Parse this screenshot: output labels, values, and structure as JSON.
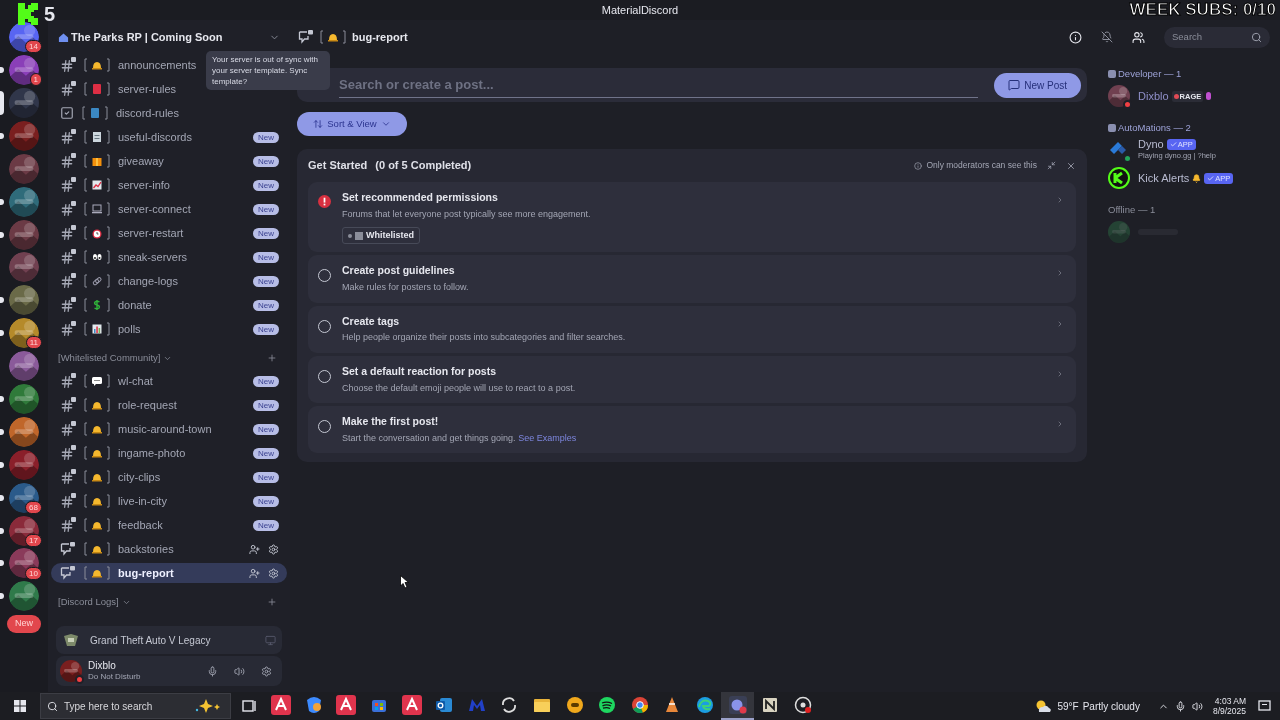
{
  "overlay": {
    "streak": "5",
    "subs": "WEEK SUBS: 0/10"
  },
  "window": {
    "title": "MaterialDiscord"
  },
  "servers": [
    {
      "badge": "14",
      "selected": false,
      "unread": false
    },
    {
      "badge": "1",
      "selected": false,
      "unread": true
    },
    {
      "selected": true
    },
    {
      "selected": false,
      "unread": true
    },
    {
      "selected": false,
      "unread": false
    },
    {
      "selected": false,
      "unread": true
    },
    {
      "selected": false,
      "unread": true
    },
    {
      "selected": false,
      "unread": false
    },
    {
      "selected": false,
      "unread": true
    },
    {
      "badge": "11",
      "selected": false,
      "unread": true
    },
    {
      "selected": false,
      "unread": false
    },
    {
      "selected": false,
      "unread": true
    },
    {
      "selected": false,
      "unread": true
    },
    {
      "selected": false,
      "unread": true
    },
    {
      "badge": "68",
      "selected": false,
      "unread": true
    },
    {
      "badge": "17",
      "selected": false,
      "unread": true
    },
    {
      "badge": "10",
      "selected": false,
      "unread": true
    },
    {
      "selected": false,
      "unread": true
    }
  ],
  "servers_new": "New",
  "server": {
    "name": "The Parks RP | Coming Soon",
    "tooltip": "Your server is out of sync with your server template. Sync template?"
  },
  "channel_groups": [
    {
      "channels": [
        {
          "kind": "text",
          "emoji": {
            "kind": "bell"
          },
          "name": "announcements",
          "selected": false
        },
        {
          "kind": "text",
          "emoji": {
            "kind": "red-book"
          },
          "name": "server-rules",
          "selected": false
        },
        {
          "kind": "rules",
          "emoji": {
            "kind": "blue-book"
          },
          "name": "discord-rules",
          "selected": false
        },
        {
          "kind": "text",
          "emoji": {
            "kind": "document"
          },
          "name": "useful-discords",
          "badge": "New",
          "selected": false
        },
        {
          "kind": "text",
          "emoji": {
            "kind": "gift"
          },
          "name": "giveaway",
          "badge": "New",
          "selected": false
        },
        {
          "kind": "text",
          "emoji": {
            "kind": "chart"
          },
          "name": "server-info",
          "badge": "New",
          "selected": false
        },
        {
          "kind": "text",
          "emoji": {
            "kind": "laptop"
          },
          "name": "server-connect",
          "badge": "New",
          "selected": false
        },
        {
          "kind": "text",
          "emoji": {
            "kind": "alarm"
          },
          "name": "server-restart",
          "badge": "New",
          "selected": false
        },
        {
          "kind": "text",
          "emoji": {
            "kind": "eyes"
          },
          "name": "sneak-servers",
          "badge": "New",
          "selected": false
        },
        {
          "kind": "text",
          "emoji": {
            "kind": "link"
          },
          "name": "change-logs",
          "badge": "New",
          "selected": false
        },
        {
          "kind": "text",
          "emoji": {
            "kind": "dollar"
          },
          "name": "donate",
          "badge": "New",
          "selected": false
        },
        {
          "kind": "text",
          "emoji": {
            "kind": "bars"
          },
          "name": "polls",
          "badge": "New",
          "selected": false
        }
      ]
    },
    {
      "name": "[Whitelisted Community]",
      "channels": [
        {
          "kind": "text",
          "emoji": {
            "kind": "speech"
          },
          "name": "wl-chat",
          "badge": "New",
          "selected": false
        },
        {
          "kind": "text",
          "emoji": {
            "kind": "bell"
          },
          "name": "role-request",
          "badge": "New",
          "selected": false
        },
        {
          "kind": "text",
          "emoji": {
            "kind": "bell"
          },
          "name": "music-around-town",
          "badge": "New",
          "selected": false
        },
        {
          "kind": "text",
          "emoji": {
            "kind": "bell"
          },
          "name": "ingame-photo",
          "badge": "New",
          "selected": false
        },
        {
          "kind": "text",
          "emoji": {
            "kind": "bell"
          },
          "name": "city-clips",
          "badge": "New",
          "selected": false
        },
        {
          "kind": "text",
          "emoji": {
            "kind": "bell"
          },
          "name": "live-in-city",
          "badge": "New",
          "selected": false
        },
        {
          "kind": "text",
          "emoji": {
            "kind": "bell"
          },
          "name": "feedback",
          "badge": "New",
          "selected": false
        },
        {
          "kind": "forum",
          "emoji": {
            "kind": "bell"
          },
          "name": "backstories",
          "actions": true,
          "selected": false
        },
        {
          "kind": "forum",
          "emoji": {
            "kind": "bell"
          },
          "name": "bug-report",
          "actions": true,
          "selected": true
        }
      ]
    },
    {
      "name": "[Discord Logs]"
    }
  ],
  "activity": {
    "game": "Grand Theft Auto V Legacy"
  },
  "user": {
    "name": "Dixblo",
    "status": "Do Not Disturb"
  },
  "header": {
    "channel": "bug-report",
    "emoji": {
      "kind": "bell"
    },
    "search_placeholder": "Search"
  },
  "forum": {
    "search_placeholder": "Search or create a post...",
    "new_post": "New Post",
    "sort": "Sort & View"
  },
  "get_started": {
    "title": "Get Started",
    "progress": "(0 of 5 Completed)",
    "note": "Only moderators can see this",
    "tasks": [
      {
        "kind": "alert",
        "title": "Set recommended permissions",
        "description": "Forums that let everyone post typically see more engagement.",
        "role": "Whitelisted"
      },
      {
        "kind": "todo",
        "title": "Create post guidelines",
        "description": "Make rules for posters to follow."
      },
      {
        "kind": "todo",
        "title": "Create tags",
        "description": "Help people organize their posts into subcategories and filter searches."
      },
      {
        "kind": "todo",
        "title": "Set a default reaction for posts",
        "description": "Choose the default emoji people will use to react to a post."
      },
      {
        "kind": "todo",
        "title": "Make the first post!",
        "description": "Start the conversation and get things going.",
        "link": "See Examples"
      }
    ]
  },
  "member_groups": [
    {
      "name": "Developer — 1",
      "members": [
        {
          "name": "Dixblo",
          "status": {
            "kind": "dnd"
          },
          "tag": "RAGE"
        }
      ]
    },
    {
      "name": "AutoMations — 2",
      "members": [
        {
          "name": "Dyno",
          "status": {
            "kind": "online"
          },
          "app": "APP",
          "activity": "Playing dyno.gg | ?help"
        },
        {
          "name": "Kick Alerts",
          "app": "APP",
          "bell": true
        }
      ]
    },
    {
      "name": "Offline — 1",
      "members": [
        {
          "status": {
            "kind": "offline"
          }
        }
      ]
    }
  ],
  "taskbar": {
    "search_placeholder": "Type here to search",
    "apps": [
      {
        "kind": "acrobat",
        "selected": false
      },
      {
        "kind": "copilot",
        "selected": false
      },
      {
        "kind": "acrobat",
        "selected": false
      },
      {
        "kind": "store",
        "selected": false
      },
      {
        "kind": "acrobat",
        "selected": false
      },
      {
        "kind": "outlook",
        "selected": false
      },
      {
        "kind": "malware",
        "selected": false
      },
      {
        "kind": "sync",
        "selected": false
      },
      {
        "kind": "folder",
        "selected": false
      },
      {
        "kind": "chat",
        "selected": false
      },
      {
        "kind": "spotify",
        "selected": false
      },
      {
        "kind": "chrome",
        "selected": false
      },
      {
        "kind": "cone",
        "selected": false
      },
      {
        "kind": "edge",
        "selected": false
      },
      {
        "kind": "discord",
        "selected": true
      },
      {
        "kind": "notes",
        "selected": false
      },
      {
        "kind": "recorder",
        "selected": false
      }
    ],
    "temperature": "59°F",
    "weather": "Partly cloudy",
    "time": "4:03 AM",
    "date": "8/9/2025"
  }
}
